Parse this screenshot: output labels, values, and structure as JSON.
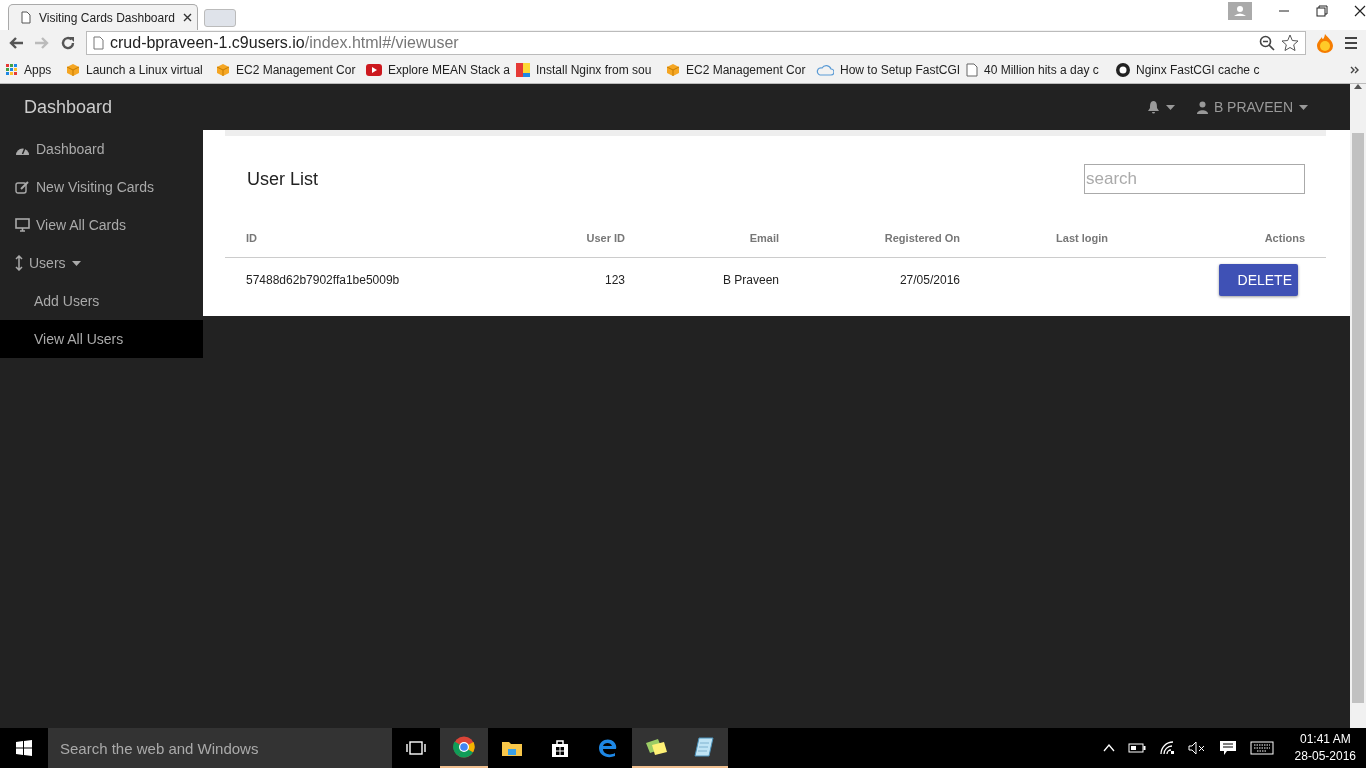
{
  "browser": {
    "tabs": [
      {
        "title": "Visiting Cards Dashboard",
        "selected": true
      }
    ],
    "address": {
      "host": "crud-bpraveen-1.c9users.io",
      "path": "/index.html#/viewuser"
    },
    "bookmarks": [
      {
        "label": "Apps",
        "kind": "apps"
      },
      {
        "label": "Launch a Linux virtual",
        "kind": "cube"
      },
      {
        "label": "EC2 Management Cor",
        "kind": "cube"
      },
      {
        "label": "Explore MEAN Stack a",
        "kind": "video"
      },
      {
        "label": "Install Nginx from sou",
        "kind": "blocks"
      },
      {
        "label": "EC2 Management Cor",
        "kind": "cube"
      },
      {
        "label": "How to Setup FastCGI",
        "kind": "cloud"
      },
      {
        "label": "40 Million hits a day c",
        "kind": "page"
      },
      {
        "label": "Nginx FastCGI cache c",
        "kind": "octocat"
      }
    ]
  },
  "app": {
    "brand": "Dashboard",
    "user": "B PRAVEEN",
    "sidebar": {
      "items": [
        {
          "label": "Dashboard",
          "kind": "gauge",
          "selected": false
        },
        {
          "label": "New Visiting Cards",
          "kind": "edit",
          "selected": false
        },
        {
          "label": "View All Cards",
          "kind": "monitor",
          "selected": false
        },
        {
          "label": "Users",
          "kind": "updown",
          "selected": false,
          "expanded": true,
          "children": [
            {
              "label": "Add Users",
              "selected": false
            },
            {
              "label": "View All Users",
              "selected": true
            }
          ]
        }
      ]
    },
    "panel": {
      "title": "User List",
      "search": {
        "placeholder": "search"
      },
      "table": {
        "columns": [
          "ID",
          "User ID",
          "Email",
          "Registered On",
          "Last login",
          "Actions"
        ],
        "rows": [
          {
            "id": "57488d62b7902ffa1be5009b",
            "user_id": "123",
            "email": "B Praveen",
            "registered_on": "27/05/2016",
            "action": "DELETE"
          }
        ]
      }
    }
  },
  "taskbar": {
    "search": {
      "placeholder": "Search the web and Windows"
    },
    "time": "01:41 AM",
    "date": "28-05-2016"
  }
}
